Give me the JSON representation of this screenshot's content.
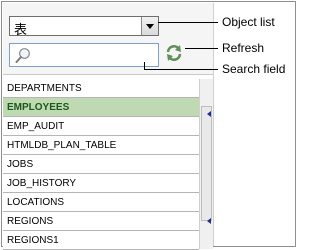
{
  "object_selector": {
    "value": "表"
  },
  "search": {
    "placeholder": ""
  },
  "objects": [
    {
      "name": "DEPARTMENTS",
      "selected": false
    },
    {
      "name": "EMPLOYEES",
      "selected": true
    },
    {
      "name": "EMP_AUDIT",
      "selected": false
    },
    {
      "name": "HTMLDB_PLAN_TABLE",
      "selected": false
    },
    {
      "name": "JOBS",
      "selected": false
    },
    {
      "name": "JOB_HISTORY",
      "selected": false
    },
    {
      "name": "LOCATIONS",
      "selected": false
    },
    {
      "name": "REGIONS",
      "selected": false
    },
    {
      "name": "REGIONS1",
      "selected": false
    }
  ],
  "callouts": {
    "object_list": "Object list",
    "refresh": "Refresh",
    "search_field": "Search field"
  },
  "colors": {
    "selected_row_bg": "#bfd9b3",
    "selected_row_text": "#1a5a1a",
    "refresh_icon": "#5f8f5a"
  },
  "icons": {
    "search": "magnifier-icon",
    "refresh": "refresh-arrows-icon",
    "dropdown": "chevron-down-icon"
  }
}
